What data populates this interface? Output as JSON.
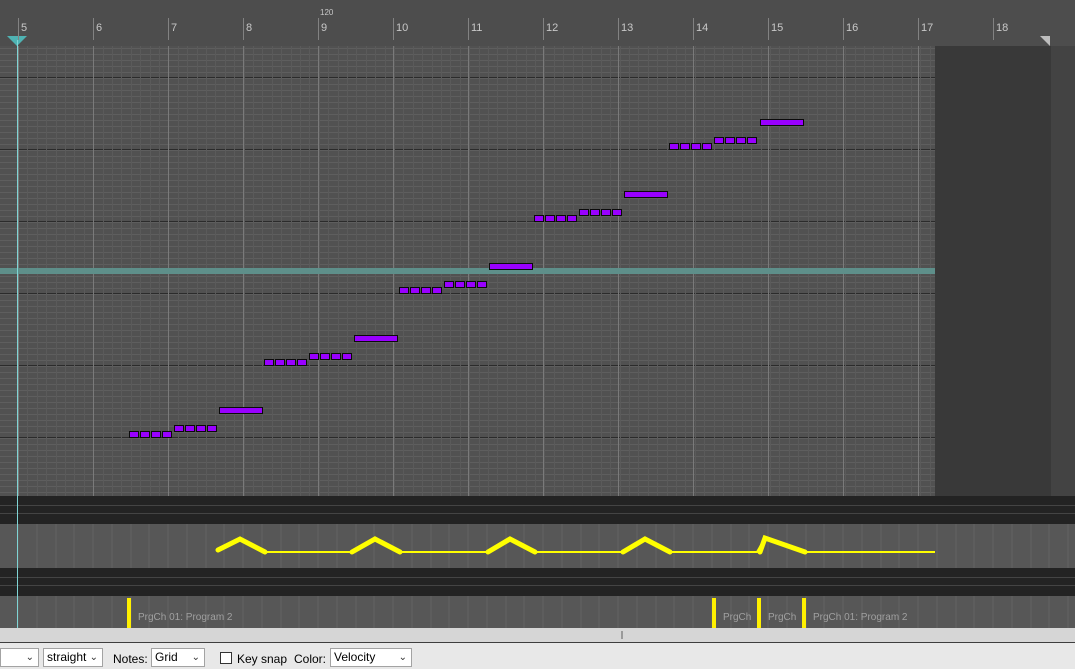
{
  "ruler": {
    "bar_labels": [
      "5",
      "6",
      "7",
      "8",
      "9",
      "10",
      "11",
      "12",
      "13",
      "14",
      "15",
      "16",
      "17",
      "18"
    ],
    "tempo_marker": "120"
  },
  "colors": {
    "note_fill": "#9900ff",
    "cc_line": "#ffff00",
    "edit_cursor": "#7fd4d4",
    "highlight_row": "#5e8f8a"
  },
  "notes": [
    {
      "pattern": "eighths",
      "bar": 6.5,
      "count": 4
    },
    {
      "pattern": "eighths",
      "bar": 7.0,
      "count": 4
    },
    {
      "pattern": "half",
      "bar": 7.5
    },
    {
      "pattern": "eighths",
      "bar": 8.2,
      "count": 4
    },
    {
      "pattern": "eighths",
      "bar": 8.8,
      "count": 4
    },
    {
      "pattern": "half",
      "bar": 9.4
    },
    {
      "pattern": "eighths",
      "bar": 10.0,
      "count": 4
    },
    {
      "pattern": "eighths",
      "bar": 10.6,
      "count": 4
    },
    {
      "pattern": "half",
      "bar": 11.2
    },
    {
      "pattern": "eighths",
      "bar": 11.8,
      "count": 4
    },
    {
      "pattern": "eighths",
      "bar": 12.4,
      "count": 4
    },
    {
      "pattern": "half",
      "bar": 13.0
    },
    {
      "pattern": "eighths",
      "bar": 13.6,
      "count": 4
    },
    {
      "pattern": "eighths",
      "bar": 14.2,
      "count": 4
    },
    {
      "pattern": "half",
      "bar": 14.8
    }
  ],
  "program_changes": {
    "labels": [
      "PrgCh 01: Program 2",
      "PrgCh",
      "PrgCh",
      "PrgCh 01: Program 2"
    ]
  },
  "toolbar": {
    "left_select_value": "",
    "swing_mode": "straight",
    "notes_label": "Notes:",
    "notes_value": "Grid",
    "keysnap_label": "Key snap",
    "keysnap_checked": false,
    "color_label": "Color:",
    "color_value": "Velocity"
  }
}
